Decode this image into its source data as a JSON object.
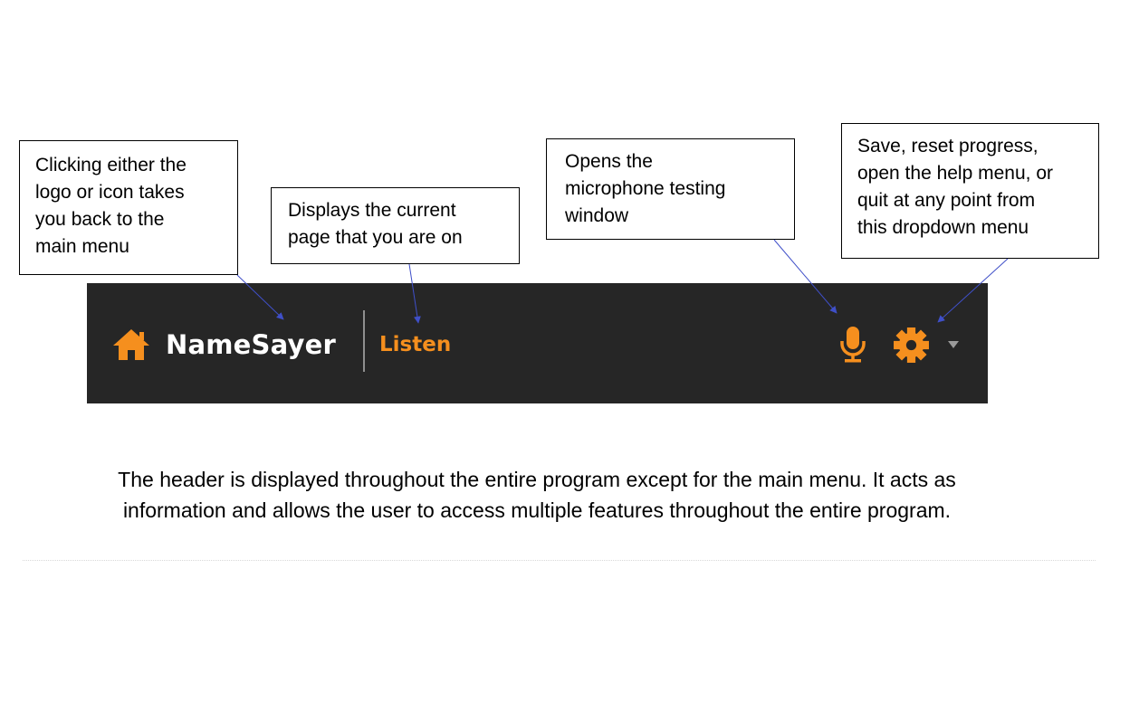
{
  "callouts": {
    "logo": "Clicking either the\nlogo or icon takes\nyou back to the\nmain menu",
    "page": "Displays the current\npage that you are on",
    "mic": "Opens the\nmicrophone testing\nwindow",
    "menu": "Save, reset progress,\nopen the help menu, or\nquit at any point from\nthis dropdown menu"
  },
  "header": {
    "brand": "NameSayer",
    "page": "Listen",
    "background_color": "#262626",
    "accent_color": "#f58f1e",
    "icons": [
      "home-icon",
      "microphone-icon",
      "gear-icon",
      "chevron-down-icon"
    ]
  },
  "caption": {
    "line1": "The header is displayed throughout the entire program except for the main menu. It acts as",
    "line2": "information and allows the user to access multiple features throughout the entire program."
  }
}
